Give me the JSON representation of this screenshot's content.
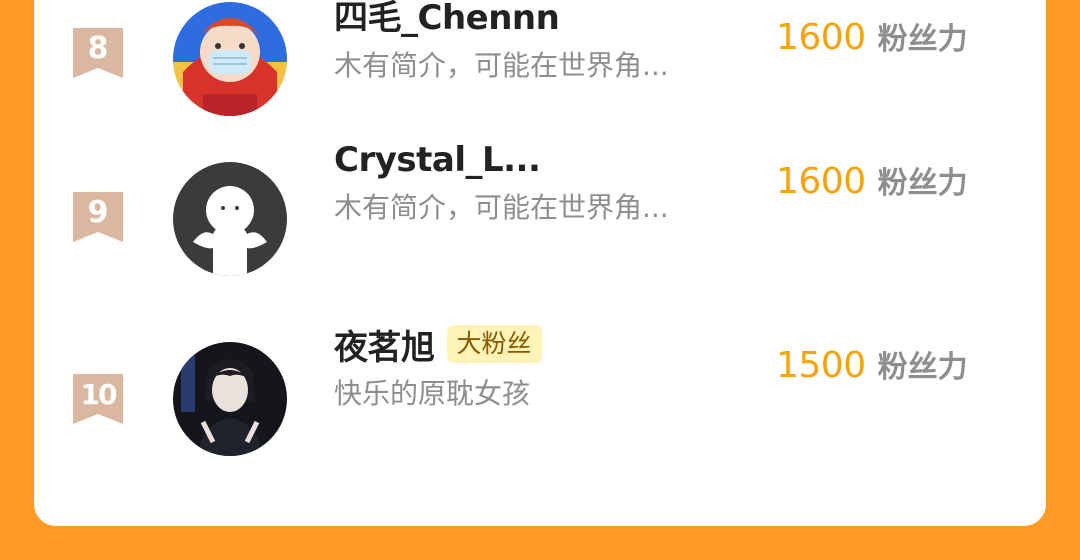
{
  "colors": {
    "page_background": "#ff9a24",
    "card_background": "#ffffff",
    "score_color": "#f6a30c",
    "rank_badge": "#d9b7a0",
    "fan_tag_background": "#fff3b8"
  },
  "leaderboard": {
    "rows": [
      {
        "rank": "8",
        "name": "四毛_Chennn",
        "bio": "木有简介，可能在世界角...",
        "score": "1600",
        "score_unit": "粉丝力",
        "avatar": "anime-character-avatar"
      },
      {
        "rank": "9",
        "name": "Crystal_L...",
        "bio": "木有简介，可能在世界角...",
        "score": "1600",
        "score_unit": "粉丝力",
        "avatar": "default-ghost-avatar"
      },
      {
        "rank": "10",
        "name": "夜茗旭",
        "tag": "大粉丝",
        "bio": "快乐的原耽女孩",
        "score": "1500",
        "score_unit": "粉丝力",
        "avatar": "dark-illustration-avatar"
      }
    ]
  }
}
